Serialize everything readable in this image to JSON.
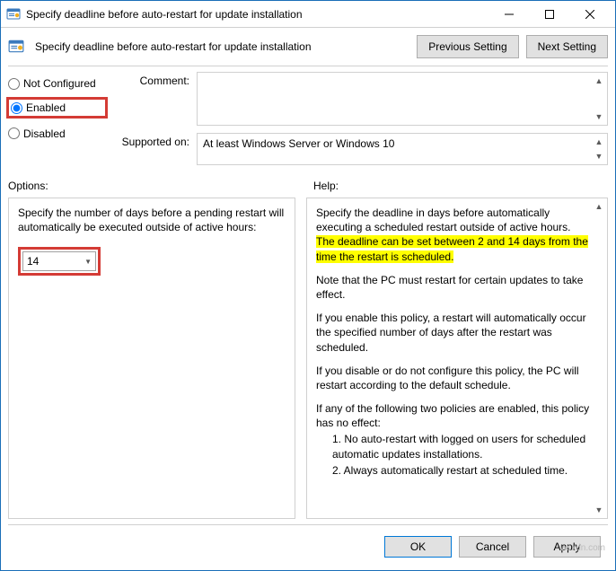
{
  "window": {
    "title": "Specify deadline before auto-restart for update installation"
  },
  "header": {
    "title": "Specify deadline before auto-restart for update installation",
    "previous_setting": "Previous Setting",
    "next_setting": "Next Setting"
  },
  "state": {
    "not_configured": "Not Configured",
    "enabled": "Enabled",
    "disabled": "Disabled",
    "selected": "enabled"
  },
  "fields": {
    "comment_label": "Comment:",
    "comment_value": "",
    "supported_label": "Supported on:",
    "supported_value": "At least Windows Server or Windows 10"
  },
  "sections": {
    "options_label": "Options:",
    "help_label": "Help:"
  },
  "options": {
    "description": "Specify the number of days before a pending restart will automatically be executed outside of active hours:",
    "days_value": "14"
  },
  "help": {
    "p1a": "Specify the deadline in days before automatically executing a scheduled restart outside of active hours. ",
    "p1b": "The deadline can be set between 2 and 14 days from the time the restart is scheduled.",
    "p2": "Note that the PC must restart for certain updates to take effect.",
    "p3": "If you enable this policy, a restart will automatically occur the specified number of days after the restart was scheduled.",
    "p4": "If you disable or do not configure this policy, the PC will restart according to the default schedule.",
    "p5": "If any of the following two policies are enabled, this policy has no effect:",
    "p5a": "1. No auto-restart with logged on users for scheduled automatic updates installations.",
    "p5b": "2. Always automatically restart at scheduled time."
  },
  "footer": {
    "ok": "OK",
    "cancel": "Cancel",
    "apply": "Apply"
  },
  "watermark": "wsxdn.com"
}
